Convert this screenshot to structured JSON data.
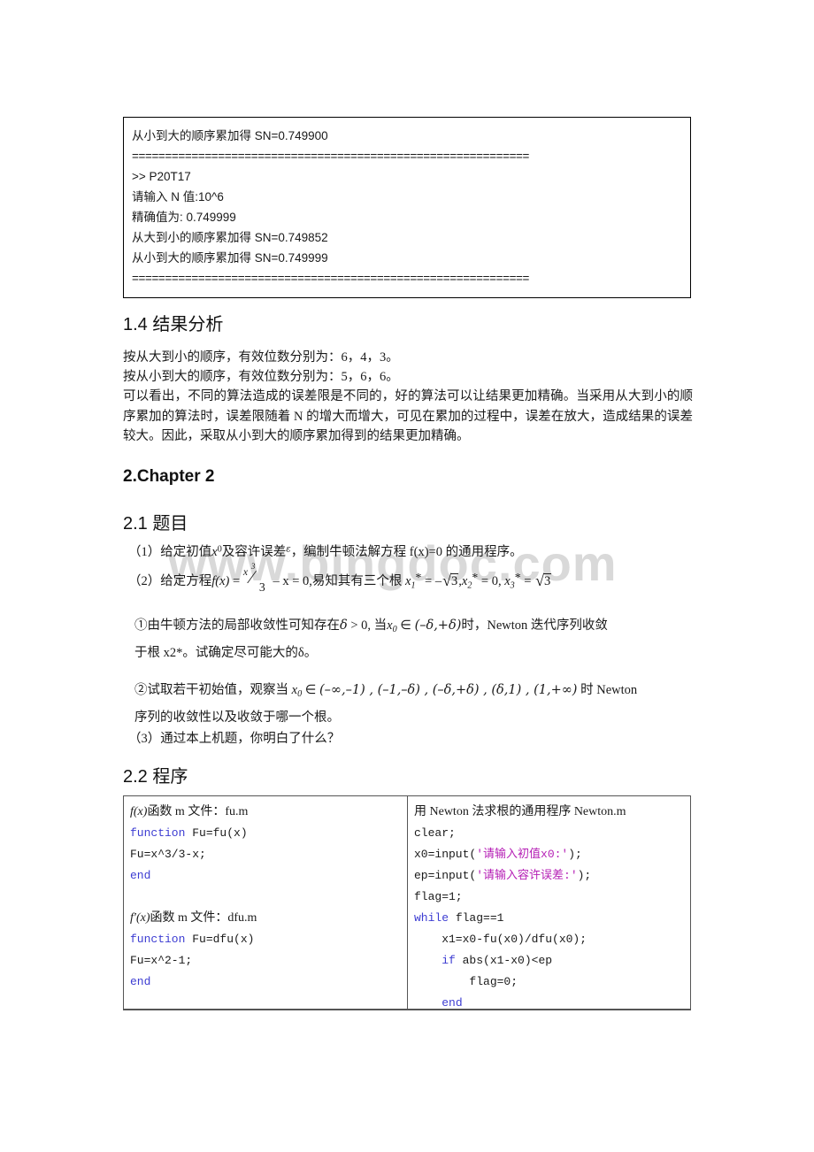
{
  "watermark": {
    "text": "www.bingdoc.com"
  },
  "console_output": {
    "lines": [
      "从小到大的顺序累加得 SN=0.749900",
      "============================================================",
      ">> P20T17",
      "请输入 N 值:10^6",
      "精确值为:   0.749999",
      "从大到小的顺序累加得 SN=0.749852",
      "从小到大的顺序累加得 SN=0.749999",
      "============================================================"
    ]
  },
  "section_1_4": {
    "heading": "1.4 结果分析",
    "line1": "按从大到小的顺序，有效位数分别为：6，4，3。",
    "line2": "按从小到大的顺序，有效位数分别为：5，6，6。",
    "paragraph": "可以看出，不同的算法造成的误差限是不同的，好的算法可以让结果更加精确。当采用从大到小的顺序累加的算法时，误差限随着 N 的增大而增大，可见在累加的过程中，误差在放大，造成结果的误差较大。因此，采取从小到大的顺序累加得到的结果更加精确。"
  },
  "chapter_2": {
    "heading": "2.Chapter 2"
  },
  "section_2_1": {
    "heading": "2.1 题目",
    "item1_pre": "（1）给定初值",
    "item1_x0": "x",
    "item1_x0_sub": "0",
    "item1_mid": "及容许误差",
    "item1_eps": "ε",
    "item1_post": "，编制牛顿法解方程 f(x)=0 的通用程序。",
    "item2_pre": "（2）给定方程",
    "item2_f": "f",
    "item2_fx": "(x)",
    "item2_eq1": " = ",
    "item2_num": "x",
    "item2_num_sup": "3",
    "item2_slash": "／",
    "item2_den": "3",
    "item2_minus": " – x  = 0",
    "item2_mid": ",易知其有三个根 ",
    "item2_root1": "x",
    "item2_root1_sub": "1",
    "item2_root1_eq": " = –",
    "item2_root1_val": "3",
    "item2_root2": "x",
    "item2_root2_sub": "2",
    "item2_root2_eq": " = 0, ",
    "item2_root3": "x",
    "item2_root3_sub": "3",
    "item2_root3_eq": " = ",
    "item2_root3_val": "3",
    "sub1_line1_a": "①由牛顿方法的局部收敛性可知存在",
    "sub1_delta": "δ",
    "sub1_gt": " > 0, ",
    "sub1_dang": "当",
    "sub1_x0": "x",
    "sub1_x0_sub": "0",
    "sub1_in": " ∈ ",
    "sub1_interval": "(–δ,+δ)",
    "sub1_line1_b": "时，Newton 迭代序列收敛",
    "sub1_line2": "于根 x2*。试确定尽可能大的δ。",
    "sub2_pre": "②试取若干初始值，观察当 ",
    "sub2_x0": "x",
    "sub2_x0_sub": "0",
    "sub2_in": " ∈ ",
    "sub2_intervals": "(–∞,–1) , (–1,–δ) , (–δ,+δ) , (δ,1) , (1,+∞)",
    "sub2_post": " 时 Newton",
    "sub2_line2": "序列的收敛性以及收敛于哪一个根。",
    "item3": "（3）通过本上机题，你明白了什么？"
  },
  "section_2_2": {
    "heading": "2.2 程序",
    "left_column": {
      "title_1_pre": "f",
      "title_1_fx": "(x)",
      "title_1_post": "函数 m 文件：fu.m",
      "code_1": [
        {
          "text": "function",
          "cls": "kw"
        },
        {
          "text": " Fu=fu(x)",
          "cls": ""
        }
      ],
      "code_2": "Fu=x^3/3-x;",
      "code_3": "end",
      "title_2_pre": "f",
      "title_2_prime": "′",
      "title_2_fx": "(x)",
      "title_2_post": "函数 m 文件：dfu.m",
      "code_4": "function",
      "code_4_rest": " Fu=dfu(x)",
      "code_5": "Fu=x^2-1;",
      "code_6": "end"
    },
    "right_column": {
      "title": "用 Newton 法求根的通用程序 Newton.m",
      "lines": [
        {
          "segments": [
            {
              "t": "clear;",
              "c": ""
            }
          ]
        },
        {
          "segments": [
            {
              "t": "x0=input(",
              "c": ""
            },
            {
              "t": "'请输入初值x0:'",
              "c": "str"
            },
            {
              "t": ");",
              "c": ""
            }
          ]
        },
        {
          "segments": [
            {
              "t": "ep=input(",
              "c": ""
            },
            {
              "t": "'请输入容许误差:'",
              "c": "str"
            },
            {
              "t": ");",
              "c": ""
            }
          ]
        },
        {
          "segments": [
            {
              "t": "flag=1;",
              "c": ""
            }
          ]
        },
        {
          "segments": [
            {
              "t": "while",
              "c": "kw"
            },
            {
              "t": " flag==1",
              "c": ""
            }
          ]
        },
        {
          "segments": [
            {
              "t": "    x1=x0-fu(x0)/dfu(x0);",
              "c": ""
            }
          ]
        },
        {
          "segments": [
            {
              "t": "    ",
              "c": ""
            },
            {
              "t": "if",
              "c": "kw"
            },
            {
              "t": " abs(x1-x0)<ep",
              "c": ""
            }
          ]
        },
        {
          "segments": [
            {
              "t": "        flag=0;",
              "c": ""
            }
          ]
        },
        {
          "segments": [
            {
              "t": "    ",
              "c": ""
            },
            {
              "t": "end",
              "c": "kw"
            }
          ]
        }
      ]
    }
  },
  "colors": {
    "keyword": "#3c3cd2",
    "string": "#b51fb5",
    "text": "#1a1a1a",
    "border": "#555555",
    "watermark": "#d9d9d9"
  }
}
